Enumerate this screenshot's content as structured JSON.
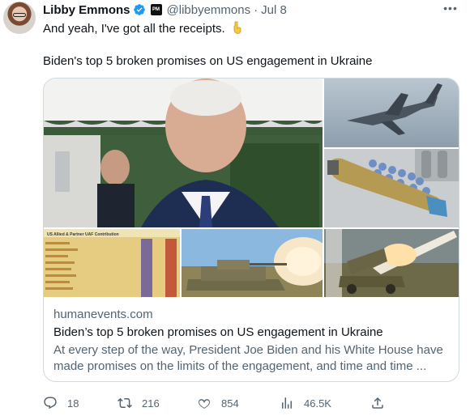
{
  "author": {
    "name": "Libby Emmons",
    "handle": "@libbyemmons",
    "separator": "·",
    "date": "Jul 8",
    "org_badge_text": "PM"
  },
  "tweet": {
    "line1": "And yeah, I've got all the receipts.",
    "line2": "Biden's top 5 broken promises on US engagement in Ukraine"
  },
  "card": {
    "domain": "humanevents.com",
    "title": "Biden’s top 5 broken promises on US engagement in Ukraine",
    "description_line1": "At every step of the way, President Joe Biden and his White House have",
    "description_line2": "made promises on the limits of the engagement, and time and time ...",
    "chart_tile_caption": "US Allied & Partner UAF Contribution"
  },
  "actions": {
    "replies": "18",
    "reposts": "216",
    "likes": "854",
    "views": "46.5K"
  },
  "icons": {
    "verified": "verified-badge-icon",
    "more": "more-options-icon",
    "reply": "reply-icon",
    "repost": "repost-icon",
    "like": "heart-icon",
    "views": "views-icon",
    "share": "share-icon",
    "hand": "pointing-down-hand-emoji"
  },
  "colors": {
    "text_primary": "#0f1419",
    "text_secondary": "#536471",
    "verified_blue": "#1d9bf0",
    "border": "#cfd9de"
  }
}
